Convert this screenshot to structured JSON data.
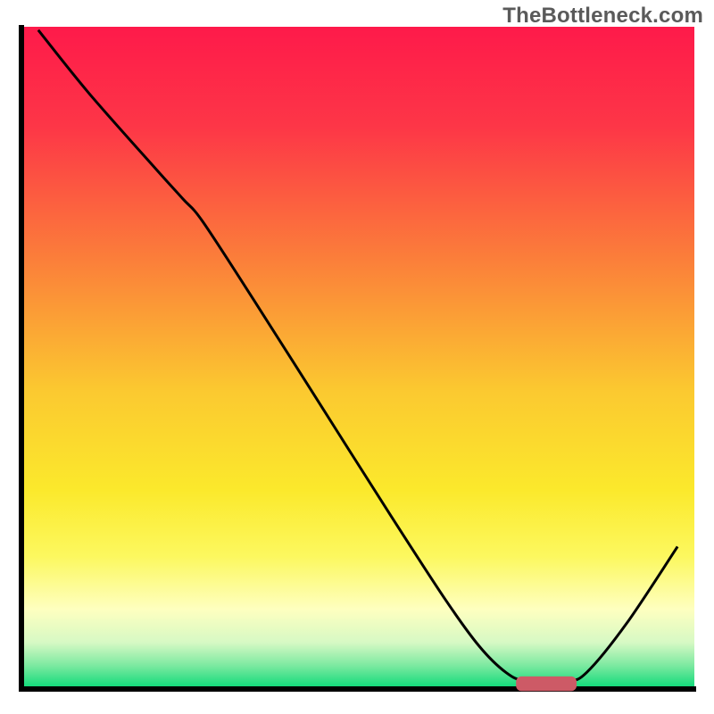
{
  "watermark": "TheBottleneck.com",
  "chart_data": {
    "type": "line",
    "title": "",
    "xlabel": "",
    "ylabel": "",
    "xlim": [
      0,
      100
    ],
    "ylim": [
      0,
      100
    ],
    "axis_color": "#000000",
    "axis_stroke_width": 6,
    "background_gradient_stops": [
      {
        "offset": 0.0,
        "color": "#fe1a4a"
      },
      {
        "offset": 0.15,
        "color": "#fd3647"
      },
      {
        "offset": 0.35,
        "color": "#fb7e3a"
      },
      {
        "offset": 0.55,
        "color": "#fbc930"
      },
      {
        "offset": 0.7,
        "color": "#fbe92c"
      },
      {
        "offset": 0.8,
        "color": "#fcf85f"
      },
      {
        "offset": 0.88,
        "color": "#feffc0"
      },
      {
        "offset": 0.93,
        "color": "#d6f9c4"
      },
      {
        "offset": 0.965,
        "color": "#7be9a0"
      },
      {
        "offset": 1.0,
        "color": "#08d977"
      }
    ],
    "series": [
      {
        "name": "bottleneck-curve",
        "stroke": "#000000",
        "stroke_width": 3,
        "points": [
          {
            "x": 2.5,
            "y": 99.5
          },
          {
            "x": 10.0,
            "y": 90.0
          },
          {
            "x": 20.0,
            "y": 78.5
          },
          {
            "x": 24.0,
            "y": 74.0
          },
          {
            "x": 27.0,
            "y": 70.5
          },
          {
            "x": 35.0,
            "y": 58.0
          },
          {
            "x": 45.0,
            "y": 42.0
          },
          {
            "x": 55.0,
            "y": 26.0
          },
          {
            "x": 63.0,
            "y": 13.5
          },
          {
            "x": 68.0,
            "y": 6.5
          },
          {
            "x": 72.0,
            "y": 2.5
          },
          {
            "x": 75.0,
            "y": 1.2
          },
          {
            "x": 81.0,
            "y": 1.2
          },
          {
            "x": 84.0,
            "y": 2.5
          },
          {
            "x": 90.0,
            "y": 10.0
          },
          {
            "x": 97.5,
            "y": 21.5
          }
        ]
      }
    ],
    "optimal_marker": {
      "name": "optimal-range-bar",
      "fill": "#cd5a66",
      "x_start": 73.5,
      "x_end": 82.5,
      "y": 0.8,
      "thickness": 2.2
    }
  }
}
